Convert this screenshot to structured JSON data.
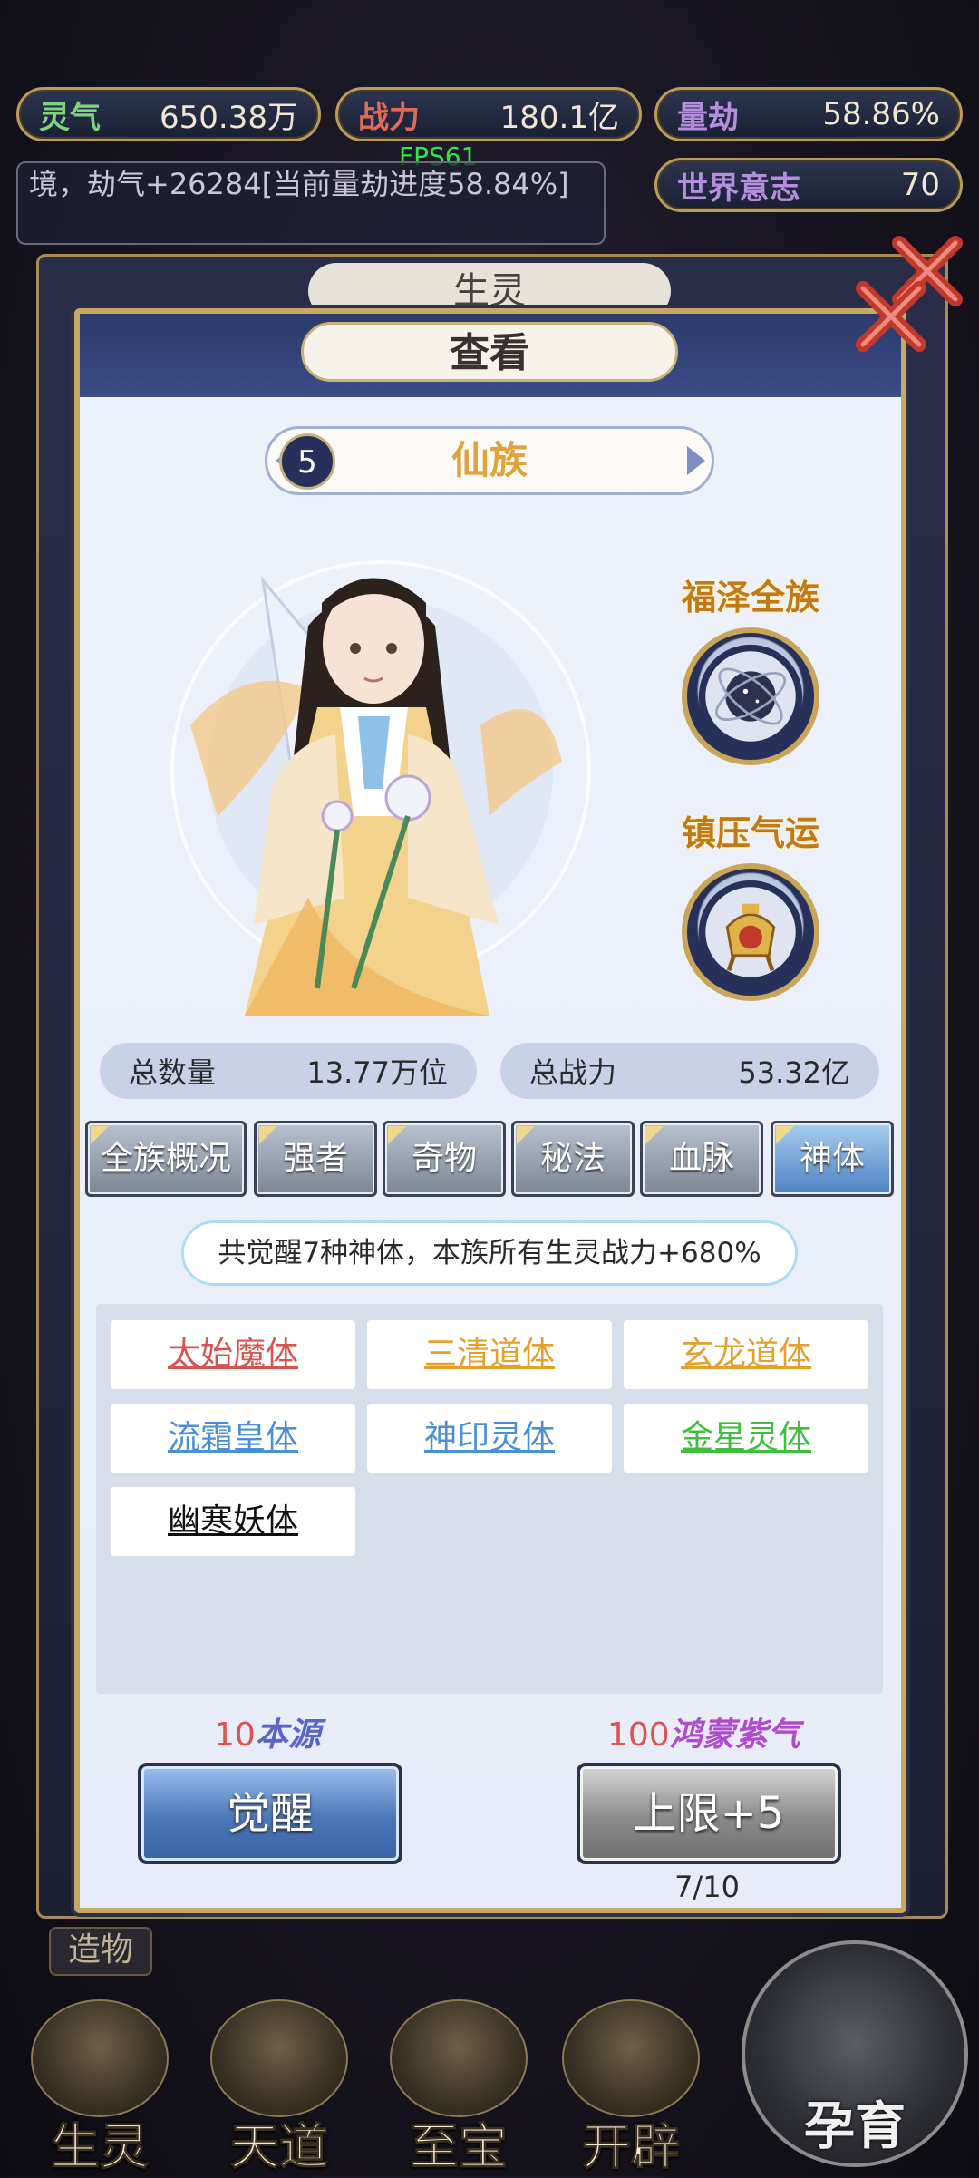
{
  "hud": {
    "lingqi": {
      "label": "灵气",
      "value": "650.38万"
    },
    "zhanli": {
      "label": "战力",
      "value": "180.1亿"
    },
    "liangjie": {
      "label": "量劫",
      "value": "58.86%"
    },
    "world_will": {
      "label": "世界意志",
      "value": "70"
    },
    "fps": "FPS61",
    "log_text": "境，劫气+26284[当前量劫进度58.84%]"
  },
  "back_panel_title": "生灵",
  "dialog": {
    "title": "查看",
    "race": {
      "level": "5",
      "name": "仙族"
    },
    "skills": [
      {
        "label": "福泽全族",
        "icon": "star-orb-icon"
      },
      {
        "label": "镇压气运",
        "icon": "cauldron-icon"
      }
    ],
    "stats": {
      "total_count_label": "总数量",
      "total_count_value": "13.77万位",
      "total_power_label": "总战力",
      "total_power_value": "53.32亿"
    },
    "tabs": [
      "全族概况",
      "强者",
      "奇物",
      "秘法",
      "血脉",
      "神体"
    ],
    "active_tab": "神体",
    "info_text": "共觉醒7种神体，本族所有生灵战力+680%",
    "bodies": [
      {
        "name": "太始魔体",
        "color": "#d9534f"
      },
      {
        "name": "三清道体",
        "color": "#e5a02c"
      },
      {
        "name": "玄龙道体",
        "color": "#e5a02c"
      },
      {
        "name": "流霜皇体",
        "color": "#4a8fd8"
      },
      {
        "name": "神印灵体",
        "color": "#4a8fd8"
      },
      {
        "name": "金星灵体",
        "color": "#3fbf3f"
      },
      {
        "name": "幽寒妖体",
        "color": "#111111"
      }
    ],
    "awaken": {
      "cost_num": "10",
      "cost_name": "本源",
      "button": "觉醒"
    },
    "limit": {
      "cost_num": "100",
      "cost_name": "鸿蒙紫气",
      "button": "上限+5",
      "progress": "7/10"
    }
  },
  "bottom_nav": {
    "create": "造物",
    "items": [
      "生灵",
      "天道",
      "至宝",
      "开辟"
    ],
    "breed": "孕育"
  },
  "colors": {
    "gold": "#c9a55a",
    "navy": "#2c3a6b",
    "panel": "#eef2fb"
  }
}
